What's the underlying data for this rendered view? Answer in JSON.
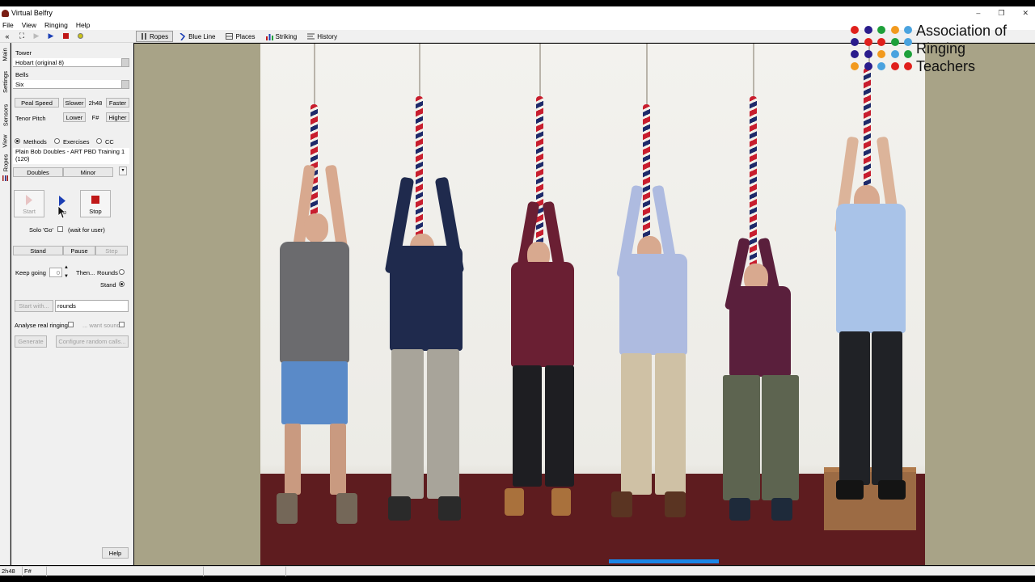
{
  "window": {
    "title": "Virtual Belfry",
    "controls": {
      "minimize": "–",
      "restore": "❐",
      "close": "✕"
    }
  },
  "menu": [
    "File",
    "View",
    "Ringing",
    "Help"
  ],
  "toolbar": {
    "tabs": [
      {
        "label": "Ropes",
        "icon": "ropes-icon",
        "active": true
      },
      {
        "label": "Blue Line",
        "icon": "blue-line-icon",
        "active": false
      },
      {
        "label": "Places",
        "icon": "places-icon",
        "active": false
      },
      {
        "label": "Striking",
        "icon": "striking-icon",
        "active": false
      },
      {
        "label": "History",
        "icon": "history-icon",
        "active": false
      }
    ]
  },
  "side_tabs": [
    "Main",
    "Settings",
    "Sensors",
    "View",
    "Ropes"
  ],
  "panel": {
    "tower_label": "Tower",
    "tower_value": "Hobart (original 8)",
    "bells_label": "Bells",
    "bells_value": "Six",
    "peal_speed_label": "Peal Speed",
    "slower_label": "Slower",
    "speed_value": "2h48",
    "faster_label": "Faster",
    "tenor_pitch_label": "Tenor Pitch",
    "lower_label": "Lower",
    "pitch_value": "F#",
    "higher_label": "Higher",
    "radio_methods": "Methods",
    "radio_exercises": "Exercises",
    "radio_cc": "CC",
    "method_value_line1": "Plain Bob Doubles - ART PBD Training 1",
    "method_value_line2": "(120)",
    "doubles_label": "Doubles",
    "minor_label": "Minor",
    "start_label": "Start",
    "go_label": "Go",
    "stop_label": "Stop",
    "solo_go_label": "Solo 'Go'",
    "wait_label": "(wait for user)",
    "stand_label": "Stand",
    "pause_label": "Pause",
    "step_label": "Step",
    "keep_going_label": "Keep going",
    "keep_going_value": "0",
    "then_label": "Then...",
    "rounds_label": "Rounds",
    "then_stand_label": "Stand",
    "start_with_label": "Start with...",
    "start_with_value": "rounds",
    "analyse_label": "Analyse real ringing",
    "want_sound_label": "... want sound",
    "generate_label": "Generate",
    "configure_label": "Configure random calls...",
    "help_label": "Help"
  },
  "logo": {
    "line1": "Association of",
    "line2": "Ringing",
    "line3": "Teachers",
    "colors": [
      "#e0201c",
      "#2a1c8c",
      "#1ea03a",
      "#f29a1e",
      "#4aa3df"
    ]
  },
  "status": {
    "speed": "2h48",
    "pitch": "F#"
  },
  "playback": {
    "progress_fraction": 0.5
  }
}
